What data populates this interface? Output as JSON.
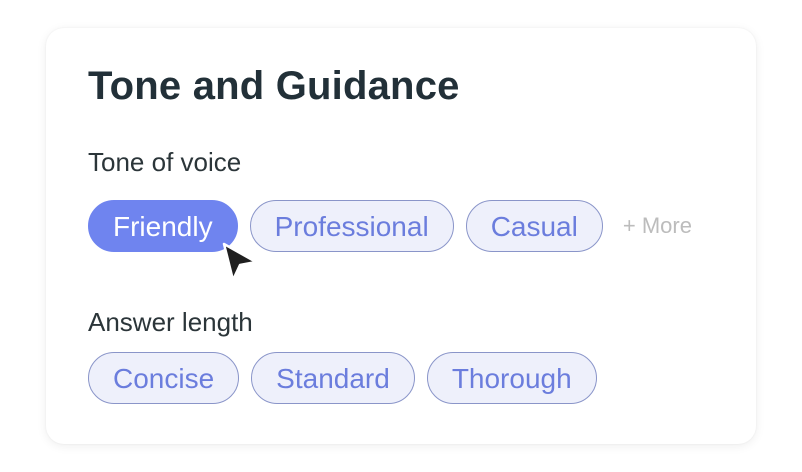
{
  "card": {
    "title": "Tone and Guidance"
  },
  "tone": {
    "label": "Tone of voice",
    "options": [
      "Friendly",
      "Professional",
      "Casual"
    ],
    "selected": "Friendly",
    "more_label": "+ More"
  },
  "length": {
    "label": "Answer length",
    "options": [
      "Concise",
      "Standard",
      "Thorough"
    ]
  },
  "colors": {
    "accent": "#6f84ef",
    "chip_text": "#6b7ddd",
    "chip_bg": "#eef0fb",
    "chip_border": "#8a95c9",
    "title_text": "#223038"
  },
  "icons": {
    "cursor": "mouse-pointer-arrow"
  }
}
